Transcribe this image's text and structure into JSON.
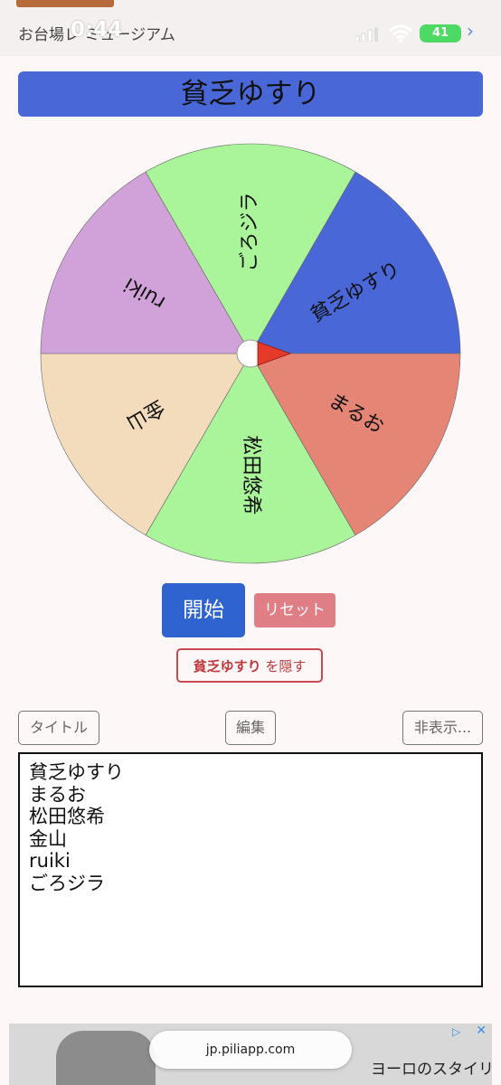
{
  "status_bar": {
    "location": "お台場レ ミュージアム",
    "time": "0:44",
    "battery": "41"
  },
  "title": "貧乏ゆすり",
  "wheel": {
    "segments": [
      {
        "label": "貧乏ゆすり",
        "color": "#4a67d8"
      },
      {
        "label": "まるお",
        "color": "#e58576"
      },
      {
        "label": "松田悠希",
        "color": "#aaf59a"
      },
      {
        "label": "金山",
        "color": "#f2dcbc"
      },
      {
        "label": "ruiki",
        "color": "#d1a2d9"
      },
      {
        "label": "ごろジラ",
        "color": "#aaf59a"
      }
    ],
    "pointer_color": "#e53a2a"
  },
  "buttons": {
    "start": "開始",
    "reset": "リセット",
    "hide_name": "貧乏ゆすり",
    "hide_suffix": "を隠す",
    "title": "タイトル",
    "edit": "編集",
    "hidden": "非表示..."
  },
  "list": [
    "貧乏ゆすり",
    "まるお",
    "松田悠希",
    "金山",
    "ruiki",
    "ごろジラ"
  ],
  "ad": {
    "text": "ヨーロのスタイリストが選ぶ"
  },
  "url": "jp.piliapp.com"
}
